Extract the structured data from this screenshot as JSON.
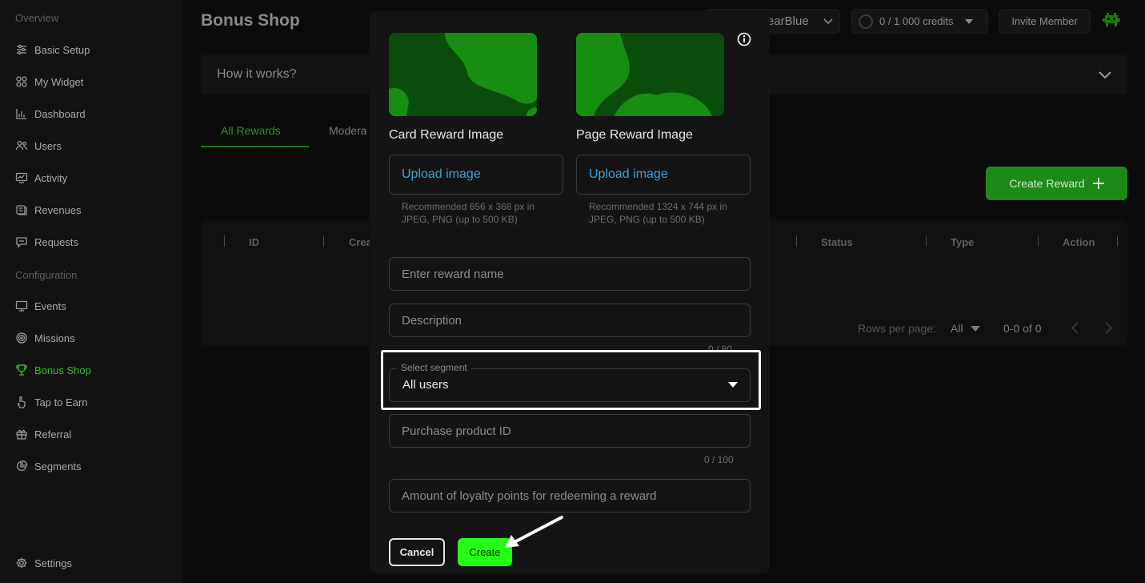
{
  "sidebar": {
    "overview_label": "Overview",
    "configuration_label": "Configuration",
    "items": [
      {
        "label": "Basic Setup",
        "icon": "sliders-icon"
      },
      {
        "label": "My Widget",
        "icon": "widget-icon"
      },
      {
        "label": "Dashboard",
        "icon": "chart-icon"
      },
      {
        "label": "Users",
        "icon": "users-icon"
      },
      {
        "label": "Activity",
        "icon": "activity-icon"
      },
      {
        "label": "Revenues",
        "icon": "coins-icon"
      },
      {
        "label": "Requests",
        "icon": "chat-icon"
      },
      {
        "label": "Events",
        "icon": "monitor-icon"
      },
      {
        "label": "Missions",
        "icon": "target-icon"
      },
      {
        "label": "Bonus Shop",
        "icon": "trophy-icon",
        "active": true
      },
      {
        "label": "Tap to Earn",
        "icon": "tap-icon"
      },
      {
        "label": "Referral",
        "icon": "gift-icon"
      },
      {
        "label": "Segments",
        "icon": "pie-icon"
      },
      {
        "label": "Settings",
        "icon": "gear-icon"
      }
    ]
  },
  "header": {
    "page_title": "Bonus Shop",
    "workspace_name": "earBlue",
    "credits": "0 / 1 000 credits",
    "invite_label": "Invite Member",
    "accent_color": "#22ff14"
  },
  "how_it_works": "How it works?",
  "tabs": [
    "All Rewards",
    "Modera"
  ],
  "create_reward_label": "Create Reward",
  "table": {
    "columns": [
      "ID",
      "Crea",
      "Status",
      "Type",
      "Action"
    ],
    "rows_per_page_label": "Rows per page:",
    "rows_per_page_value": "All",
    "range": "0-0 of 0"
  },
  "modal": {
    "card_image_label": "Card Reward Image",
    "page_image_label": "Page Reward Image",
    "upload_label": "Upload image",
    "card_hint": "Recommended 656 x 368 px in JPEG, PNG (up to 500 KB)",
    "page_hint": "Recommended 1324 x 744 px in JPEG, PNG (up to 500 KB)",
    "reward_name_placeholder": "Enter reward name",
    "description_placeholder": "Description",
    "description_counter": "0 / 80",
    "segment_label": "Select segment",
    "segment_value": "All users",
    "product_id_placeholder": "Purchase product ID",
    "product_id_counter": "0 / 100",
    "loyalty_placeholder": "Amount of loyalty points for redeeming a reward",
    "cancel_label": "Cancel",
    "create_label": "Create"
  }
}
